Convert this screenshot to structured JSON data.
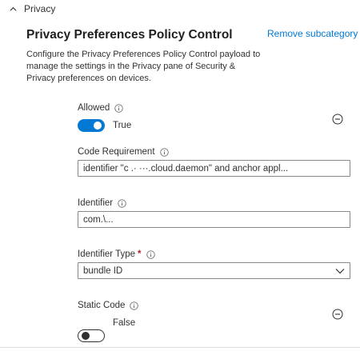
{
  "section": {
    "label": "Privacy",
    "expanded": true
  },
  "header": {
    "title": "Privacy Preferences Policy Control",
    "remove_link": "Remove subcategory",
    "description": "Configure the Privacy Preferences Policy Control payload to manage the settings in the Privacy pane of Security & Privacy preferences on devices."
  },
  "fields": {
    "allowed": {
      "label": "Allowed",
      "state": true,
      "state_text": "True"
    },
    "code_requirement": {
      "label": "Code Requirement",
      "value": "identifier \"c                  .· ···.cloud.daemon\" and anchor appl..."
    },
    "identifier": {
      "label": "Identifier",
      "value": "com.\\..."
    },
    "identifier_type": {
      "label": "Identifier Type",
      "required_mark": "*",
      "value": "bundle ID"
    },
    "static_code": {
      "label": "Static Code",
      "state": false,
      "state_text": "False"
    }
  },
  "icons": {
    "section_chevron": "chevron-up-icon",
    "info": "info-icon",
    "remove": "remove-circle-icon",
    "dropdown": "chevron-down-icon"
  },
  "colors": {
    "accent": "#0078d4",
    "required": "#a4262c",
    "text": "#323130",
    "border": "#8a8886"
  }
}
